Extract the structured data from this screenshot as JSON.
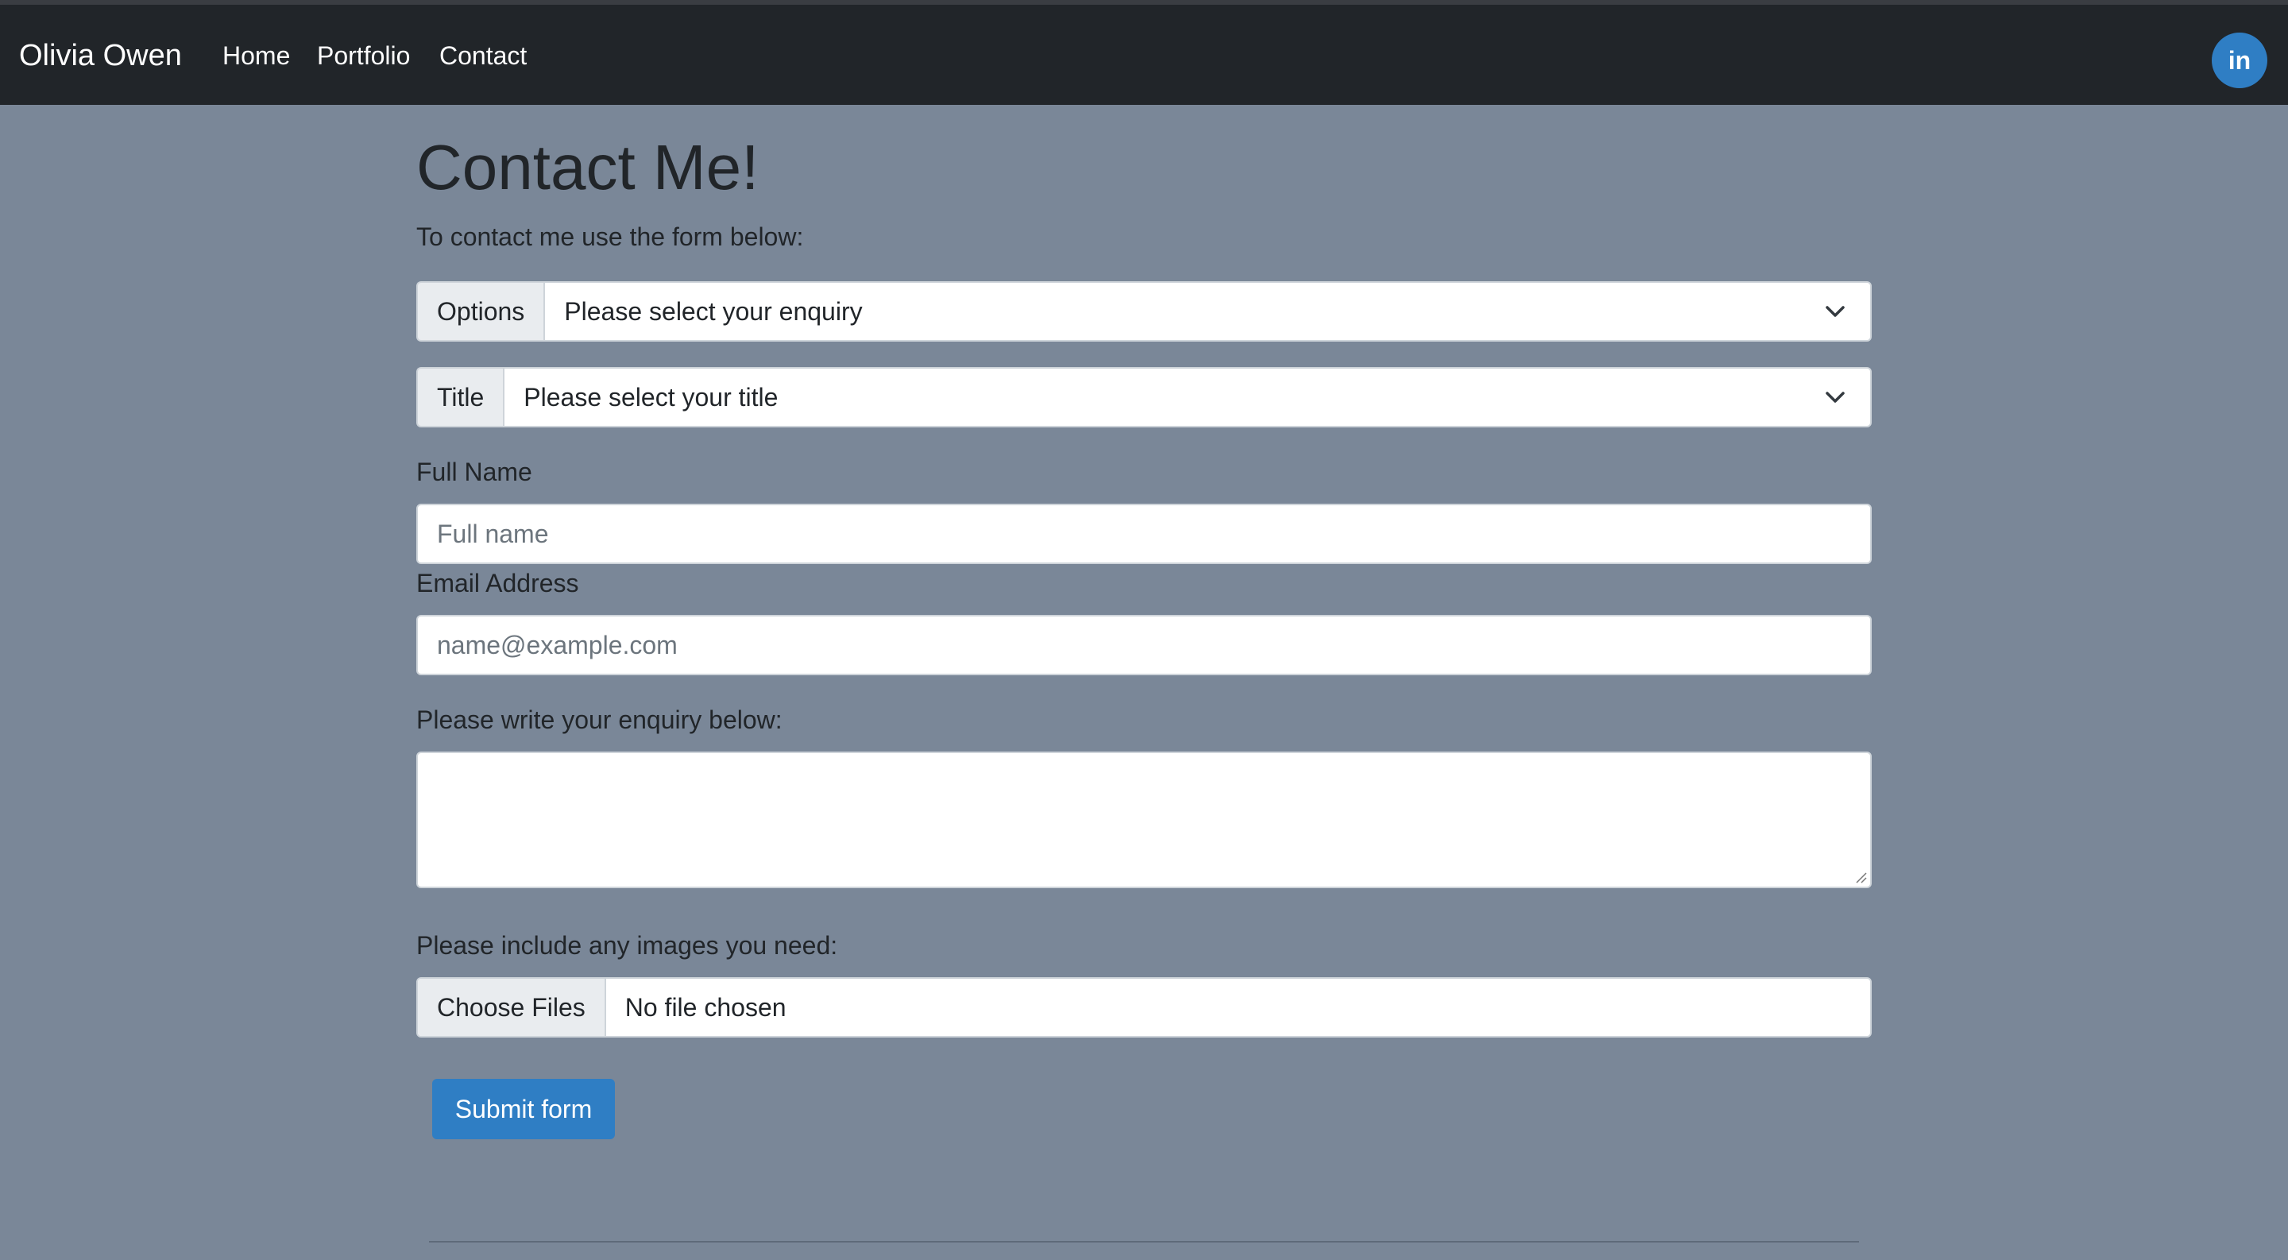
{
  "navbar": {
    "brand": "Olivia Owen",
    "links": [
      "Home",
      "Portfolio",
      "Contact"
    ],
    "social_icon_text": "in",
    "social_icon": "linkedin-icon",
    "background_color": "#212529",
    "social_color": "#2f7ec4"
  },
  "page": {
    "title": "Contact Me!",
    "intro": "To contact me use the form below:",
    "background_color": "#7a8798"
  },
  "form": {
    "options_addon": "Options",
    "options_select": "Please select your enquiry",
    "title_addon": "Title",
    "title_select": "Please select your title",
    "full_name_label": "Full Name",
    "full_name_placeholder": "Full name",
    "full_name_value": "",
    "email_label": "Email Address",
    "email_placeholder": "name@example.com",
    "email_value": "",
    "enquiry_label": "Please write your enquiry below:",
    "enquiry_value": "",
    "images_label": "Please include any images you need:",
    "file_button": "Choose Files",
    "file_status": "No file chosen",
    "submit_label": "Submit form",
    "submit_color": "#2f7ec4"
  }
}
